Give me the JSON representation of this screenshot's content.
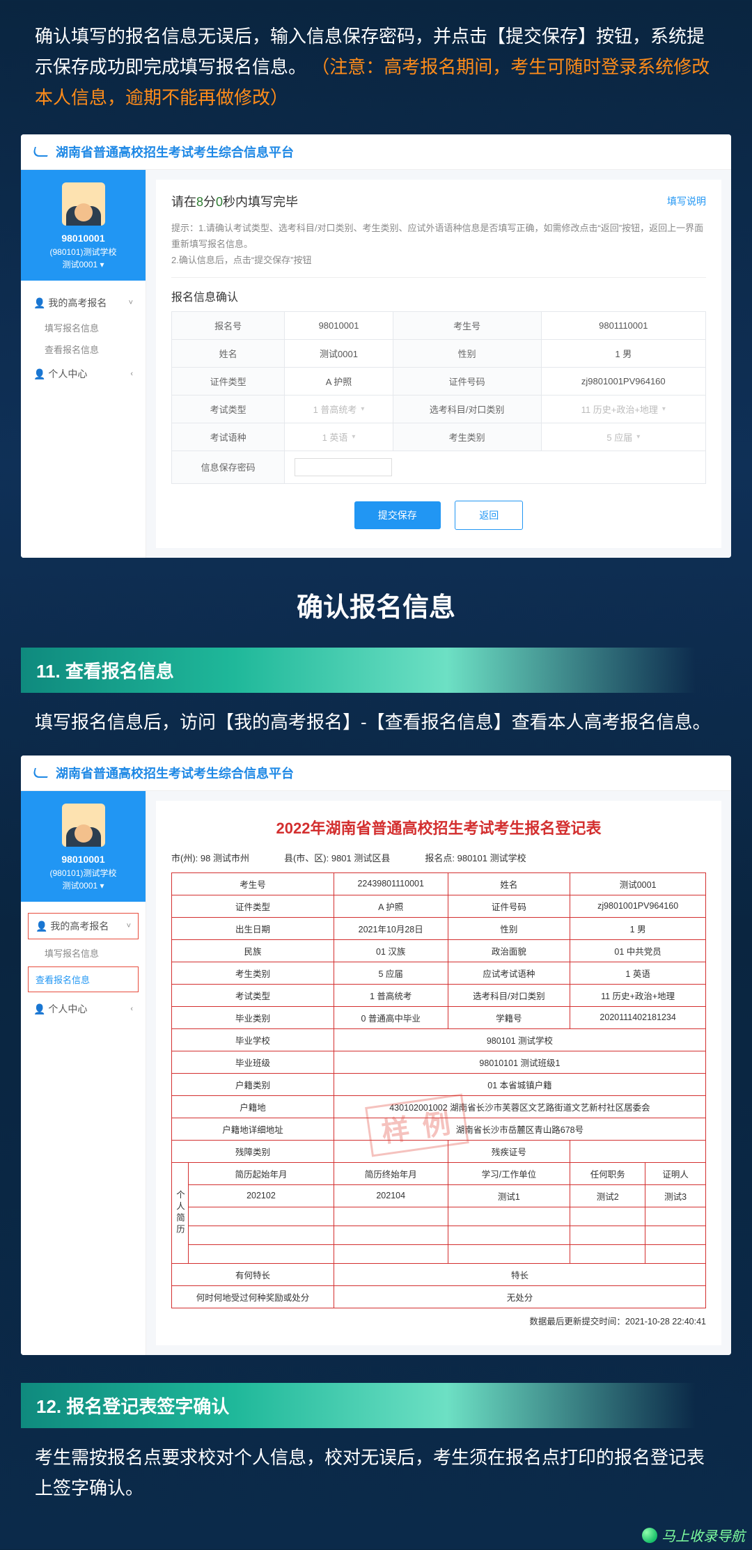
{
  "intro": {
    "part1": "确认填写的报名信息无误后，输入信息保存密码，并点击【提交保存】按钮，系统提示保存成功即完成填写报名信息。",
    "part2": "（注意：高考报名期间，考生可随时登录系统修改本人信息，逾期不能再做修改）"
  },
  "platform_title": "湖南省普通高校招生考试考生综合信息平台",
  "user": {
    "id": "98010001",
    "line2": "(980101)测试学校",
    "line3": "测试0001 ▾"
  },
  "nav": {
    "group1": "我的高考报名",
    "sub1": "填写报名信息",
    "sub2": "查看报名信息",
    "group2": "个人中心",
    "chev_down": "˅",
    "chev_left": "‹"
  },
  "icon_user": "👤",
  "shot1": {
    "timer_pre": "请在",
    "timer_min": "8",
    "timer_mid": "分",
    "timer_sec": "0",
    "timer_post": "秒内填写完毕",
    "instruct": "填写说明",
    "tip1": "提示：1.请确认考试类型、选考科目/对口类别、考生类别、应试外语语种信息是否填写正确，如需修改点击“返回”按钮，返回上一界面重新填写报名信息。",
    "tip2": "2.确认信息后，点击“提交保存”按钮",
    "section": "报名信息确认",
    "labels": {
      "bmh": "报名号",
      "ksh": "考生号",
      "xm": "姓名",
      "xb": "性别",
      "zjlx": "证件类型",
      "zjhm": "证件号码",
      "kslx": "考试类型",
      "xk": "选考科目/对口类别",
      "yz": "考试语种",
      "kslb": "考生类别",
      "pw": "信息保存密码"
    },
    "values": {
      "bmh": "98010001",
      "ksh": "9801110001",
      "xm": "测试0001",
      "xb": "1 男",
      "zjlx": "A 护照",
      "zjhm": "zj9801001PV964160",
      "kslx": "1 普高统考",
      "xk": "11 历史+政治+地理",
      "yz": "1 英语",
      "kslb": "5 应届"
    },
    "btn_submit": "提交保存",
    "btn_back": "返回"
  },
  "big_heading": "确认报名信息",
  "step11": {
    "title": "11. 查看报名信息",
    "body": "填写报名信息后，访问【我的高考报名】-【查看报名信息】查看本人高考报名信息。"
  },
  "shot2": {
    "form_title": "2022年湖南省普通高校招生考试考生报名登记表",
    "meta": {
      "city": "市(州): 98 测试市州",
      "county": "县(市、区): 9801 测试区县",
      "site": "报名点: 980101 测试学校"
    },
    "labels": {
      "ksh": "考生号",
      "xm": "姓名",
      "zjlx": "证件类型",
      "zjhm": "证件号码",
      "birth": "出生日期",
      "xb": "性别",
      "mz": "民族",
      "zzmm": "政治面貌",
      "kslb": "考生类别",
      "yz": "应试考试语种",
      "kslx": "考试类型",
      "xk": "选考科目/对口类别",
      "bylb": "毕业类别",
      "xjh": "学籍号",
      "byxx": "毕业学校",
      "bybj": "毕业班级",
      "hjlb": "户籍类别",
      "hjd": "户籍地",
      "hjxx": "户籍地详细地址",
      "cjlb": "残障类别",
      "cjzh": "残疾证号",
      "resume": "个人简历",
      "jlqs": "简历起始年月",
      "jlzz": "简历终始年月",
      "dw": "学习/工作单位",
      "zw": "任何职务",
      "zmr": "证明人",
      "tc": "有何特长",
      "jc": "何时何地受过何种奖励或处分"
    },
    "values": {
      "ksh": "22439801110001",
      "xm": "测试0001",
      "zjlx": "A 护照",
      "zjhm": "zj9801001PV964160",
      "birth": "2021年10月28日",
      "xb": "1 男",
      "mz": "01 汉族",
      "zzmm": "01 中共党员",
      "kslb": "5 应届",
      "yz": "1 英语",
      "kslx": "1 普高统考",
      "xk": "11 历史+政治+地理",
      "bylb": "0 普通高中毕业",
      "xjh": "2020111402181234",
      "byxx": "980101 测试学校",
      "bybj": "98010101 测试班级1",
      "hjlb": "01 本省城镇户籍",
      "hjd": "430102001002 湖南省长沙市芙蓉区文艺路街道文艺新村社区居委会",
      "hjxx": "湖南省长沙市岳麓区青山路678号",
      "cjlb": "",
      "jlqs": "202102",
      "jlzz": "202104",
      "dw": "测试1",
      "zw": "测试2",
      "zmr": "测试3",
      "tc": "特长",
      "jc": "无处分"
    },
    "stamp": "样 例",
    "timestamp": "数据最后更新提交时间：2021-10-28 22:40:41"
  },
  "step12": {
    "title": "12. 报名登记表签字确认",
    "body": "考生需按报名点要求校对个人信息，校对无误后，考生须在报名点打印的报名登记表上签字确认。"
  },
  "watermark": "马上收录导航"
}
